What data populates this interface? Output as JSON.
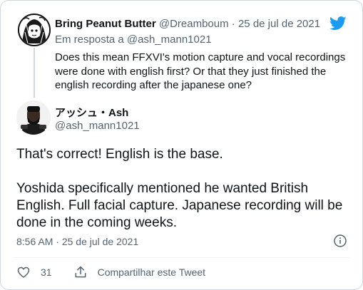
{
  "parent": {
    "display_name": "Bring Peanut Butter",
    "handle": "@Dreamboum",
    "separator": "·",
    "date": "25 de jul de 2021",
    "reply_prefix": "Em resposta a",
    "reply_handle": "@ash_mann1021",
    "text": "Does this mean FFXVI's motion capture and vocal recordings were done with english first? Or that they just finished the english recording after the japanese one?"
  },
  "main": {
    "display_name": "アッシュ・Ash",
    "handle": "@ash_mann1021",
    "paragraphs": [
      "That's correct! English is the base.",
      "Yoshida specifically mentioned he wanted British English. Full facial capture. Japanese recording will be done in the coming weeks."
    ],
    "time": "8:56 AM",
    "separator": "·",
    "date": "25 de jul de 2021"
  },
  "actions": {
    "like_count": "31",
    "share_label": "Compartilhar este Tweet"
  },
  "colors": {
    "twitter_blue": "#1d9bf0",
    "secondary_text": "#536471",
    "border": "#cfd9de"
  },
  "icons": [
    "twitter-bird-icon",
    "info-icon",
    "heart-icon",
    "share-icon"
  ]
}
